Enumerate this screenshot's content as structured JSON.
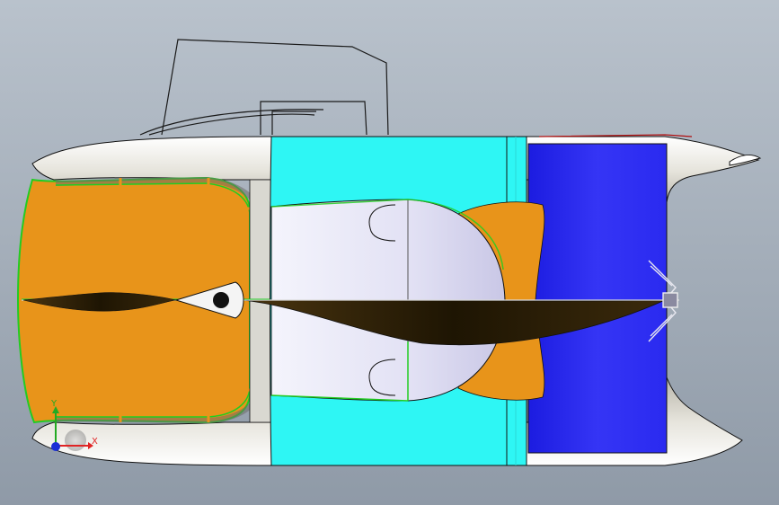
{
  "view": {
    "background_top": "#b9c2cc",
    "background_bottom": "#8f9aa7"
  },
  "colors": {
    "hull": "#e9e8e2",
    "hull_shadow": "#bcbab1",
    "deck_orange": "#e8941a",
    "cabin_cyan": "#2ef6f4",
    "cabin_dome": "#e7e6f7",
    "stern_blue": "#2727f0",
    "sail_dark": "#2b1d05",
    "edge_green": "#22cc22",
    "outline": "#111111"
  },
  "triad": {
    "x_label": "X",
    "y_label": "Y",
    "x_color": "#e02424",
    "y_color": "#22aa22",
    "z_color": "#1a2fd6"
  }
}
